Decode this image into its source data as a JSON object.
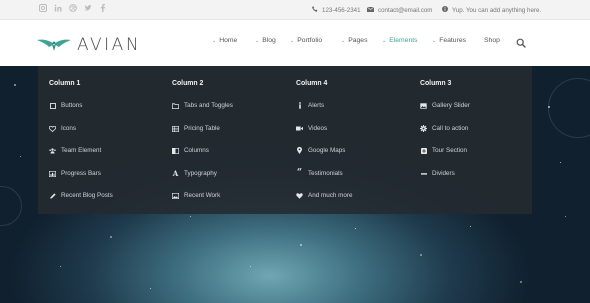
{
  "topbar": {
    "social_icons": [
      "instagram-icon",
      "linkedin-icon",
      "dribbble-icon",
      "twitter-icon",
      "facebook-icon"
    ],
    "phone": "123-456-2341",
    "email": "contact@email.com",
    "tagline": "Yup. You can add anything here."
  },
  "brand": {
    "name": "AVIAN",
    "accent": "#3ea594"
  },
  "nav": {
    "items": [
      {
        "label": "Home",
        "has_dropdown": true
      },
      {
        "label": "Blog",
        "has_dropdown": true
      },
      {
        "label": "Portfolio",
        "has_dropdown": true
      },
      {
        "label": "Pages",
        "has_dropdown": true
      },
      {
        "label": "Elements",
        "has_dropdown": true,
        "active": true
      },
      {
        "label": "Features",
        "has_dropdown": true
      },
      {
        "label": "Shop",
        "has_dropdown": false
      }
    ]
  },
  "mega_menu": {
    "columns": [
      {
        "title": "Column 1",
        "items": [
          {
            "label": "Buttons",
            "icon": "square-icon"
          },
          {
            "label": "Icons",
            "icon": "heart-icon"
          },
          {
            "label": "Team Element",
            "icon": "users-icon"
          },
          {
            "label": "Progress Bars",
            "icon": "bar-chart-icon"
          },
          {
            "label": "Recent Blog Posts",
            "icon": "pencil-icon"
          }
        ]
      },
      {
        "title": "Column 2",
        "items": [
          {
            "label": "Tabs and Toggles",
            "icon": "folder-icon"
          },
          {
            "label": "Pricing Table",
            "icon": "table-icon"
          },
          {
            "label": "Columns",
            "icon": "columns-icon"
          },
          {
            "label": "Typography",
            "icon": "font-icon"
          },
          {
            "label": "Recent Work",
            "icon": "image-icon"
          }
        ]
      },
      {
        "title": "Column 4",
        "items": [
          {
            "label": "Alerts",
            "icon": "info-icon"
          },
          {
            "label": "Videos",
            "icon": "video-icon"
          },
          {
            "label": "Google Maps",
            "icon": "map-marker-icon"
          },
          {
            "label": "Testimonials",
            "icon": "quote-icon"
          },
          {
            "label": "And much more",
            "icon": "heart-icon"
          }
        ]
      },
      {
        "title": "Column 3",
        "items": [
          {
            "label": "Gallery Slider",
            "icon": "picture-icon"
          },
          {
            "label": "Call to action",
            "icon": "gear-icon"
          },
          {
            "label": "Tour Section",
            "icon": "plus-square-icon"
          },
          {
            "label": "Dividers",
            "icon": "minus-icon"
          }
        ]
      }
    ]
  }
}
